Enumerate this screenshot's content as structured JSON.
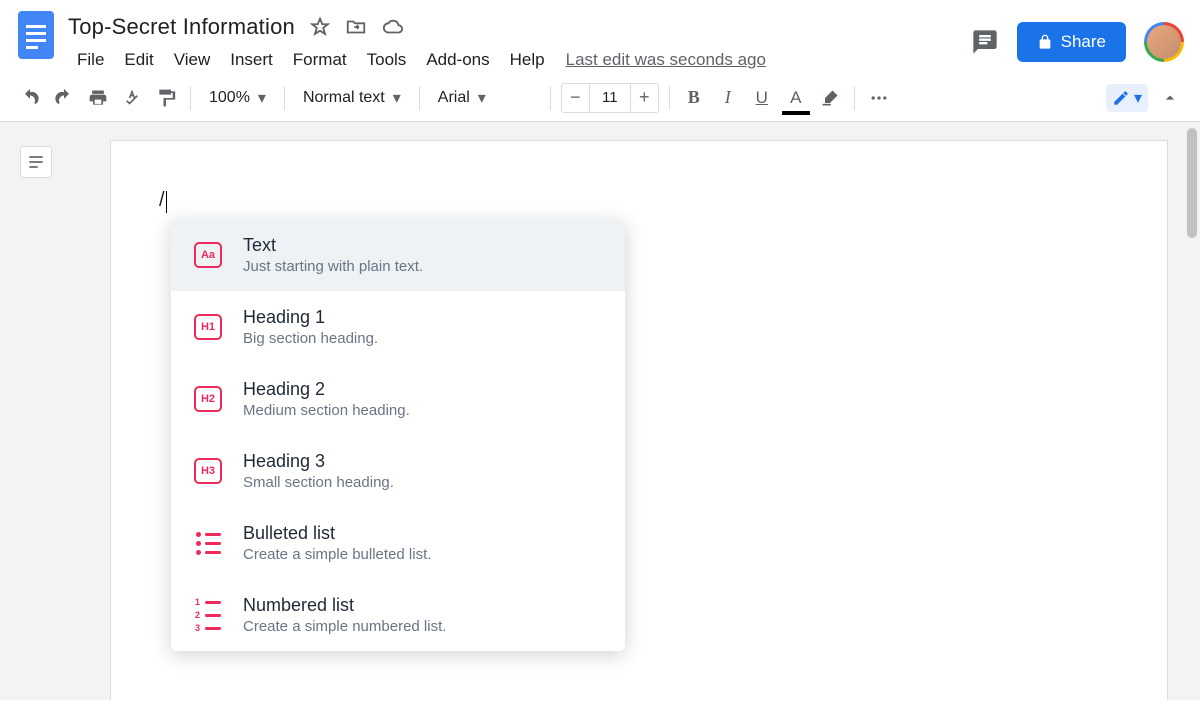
{
  "header": {
    "doc_title": "Top-Secret Information",
    "last_edit": "Last edit was seconds ago",
    "share_label": "Share"
  },
  "menu": {
    "file": "File",
    "edit": "Edit",
    "view": "View",
    "insert": "Insert",
    "format": "Format",
    "tools": "Tools",
    "addons": "Add-ons",
    "help": "Help"
  },
  "toolbar": {
    "zoom": "100%",
    "style": "Normal text",
    "font": "Arial",
    "font_size": "11",
    "bold_glyph": "B",
    "italic_glyph": "I",
    "underline_glyph": "U",
    "textcolor_glyph": "A"
  },
  "document": {
    "typed": "/"
  },
  "popup": {
    "items": [
      {
        "icon": "Aa",
        "title": "Text",
        "desc": "Just starting with plain text.",
        "selected": true,
        "type": "box"
      },
      {
        "icon": "H1",
        "title": "Heading 1",
        "desc": "Big section heading.",
        "selected": false,
        "type": "box"
      },
      {
        "icon": "H2",
        "title": "Heading 2",
        "desc": "Medium section heading.",
        "selected": false,
        "type": "box"
      },
      {
        "icon": "H3",
        "title": "Heading 3",
        "desc": "Small section heading.",
        "selected": false,
        "type": "box"
      },
      {
        "icon": "bullets",
        "title": "Bulleted list",
        "desc": "Create a simple bulleted list.",
        "selected": false,
        "type": "bullets"
      },
      {
        "icon": "numbers",
        "title": "Numbered list",
        "desc": "Create a simple numbered list.",
        "selected": false,
        "type": "numbers"
      }
    ]
  }
}
